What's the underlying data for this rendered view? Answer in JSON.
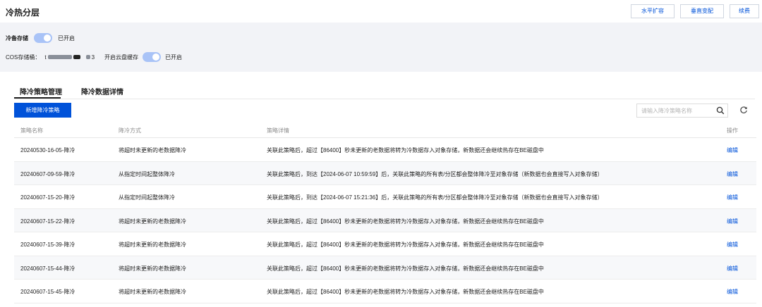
{
  "header": {
    "title": "冷热分层",
    "buttons": [
      "水平扩容",
      "垂直变配",
      "续费"
    ]
  },
  "settings": {
    "cold_storage_label": "冷备存储",
    "cold_storage_status": "已开启",
    "cos_bucket_label": "COS存储桶：",
    "cos_bucket_prefix": "t",
    "cos_bucket_suffix": "3",
    "cloud_disk_cache_label": "开启云盘缓存",
    "cloud_disk_cache_status": "已开启",
    "colors": {
      "toggle_on": "#a9c3f7",
      "background": "#f2f3f7"
    }
  },
  "tabs": [
    {
      "label": "降冷策略管理",
      "active": true
    },
    {
      "label": "降冷数据详情",
      "active": false
    }
  ],
  "toolbar": {
    "add_button_label": "新增降冷策略",
    "search_placeholder": "请输入降冷策略名称",
    "search_icon": "search-icon",
    "refresh_icon": "refresh-icon"
  },
  "table": {
    "columns": [
      "策略名称",
      "降冷方式",
      "策略详情",
      "操作"
    ],
    "rows": [
      {
        "name": "20240530-16-05-降冷",
        "method": "将超时未更新的老数据降冷",
        "detail": "关联此策略后，超过【86400】秒未更新的老数据将转为冷数据存入对象存储，新数据还会继续热存在BE磁盘中",
        "action": "编辑"
      },
      {
        "name": "20240607-09-59-降冷",
        "method": "从指定时间起整体降冷",
        "detail": "关联此策略后，到达【2024-06-07 10:59:59】后，关联此策略的所有表/分区都会整体降冷至对象存储（新数据也会直接写入对象存储）",
        "action": "编辑"
      },
      {
        "name": "20240607-15-20-降冷",
        "method": "从指定时间起整体降冷",
        "detail": "关联此策略后，到达【2024-06-07 15:21:36】后，关联此策略的所有表/分区都会整体降冷至对象存储（新数据也会直接写入对象存储）",
        "action": "编辑"
      },
      {
        "name": "20240607-15-22-降冷",
        "method": "将超时未更新的老数据降冷",
        "detail": "关联此策略后，超过【86400】秒未更新的老数据将转为冷数据存入对象存储，新数据还会继续热存在BE磁盘中",
        "action": "编辑"
      },
      {
        "name": "20240607-15-39-降冷",
        "method": "将超时未更新的老数据降冷",
        "detail": "关联此策略后，超过【86400】秒未更新的老数据将转为冷数据存入对象存储，新数据还会继续热存在BE磁盘中",
        "action": "编辑"
      },
      {
        "name": "20240607-15-44-降冷",
        "method": "将超时未更新的老数据降冷",
        "detail": "关联此策略后，超过【86400】秒未更新的老数据将转为冷数据存入对象存储，新数据还会继续热存在BE磁盘中",
        "action": "编辑"
      },
      {
        "name": "20240607-15-45-降冷",
        "method": "将超时未更新的老数据降冷",
        "detail": "关联此策略后，超过【86400】秒未更新的老数据将转为冷数据存入对象存储，新数据还会继续热存在BE磁盘中",
        "action": "编辑"
      }
    ]
  }
}
